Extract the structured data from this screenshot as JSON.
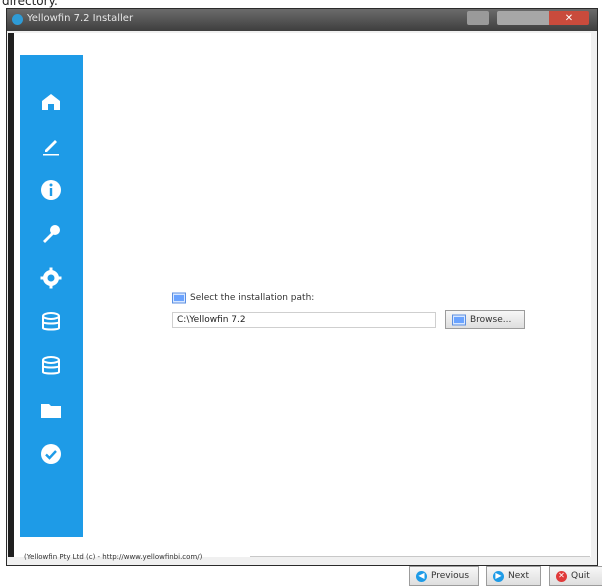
{
  "top_cropped_text": "directory.",
  "window": {
    "title": "Yellowfin 7.2 Installer",
    "close_symbol": "✕",
    "icon": "yellowfin-logo-icon"
  },
  "sidebar": {
    "color": "#1e9be7",
    "items": [
      {
        "icon": "home-icon"
      },
      {
        "icon": "pen-icon"
      },
      {
        "icon": "info-icon"
      },
      {
        "icon": "key-icon"
      },
      {
        "icon": "gear-icon"
      },
      {
        "icon": "database-icon"
      },
      {
        "icon": "database-stack-icon"
      },
      {
        "icon": "folder-icon"
      },
      {
        "icon": "check-icon"
      }
    ]
  },
  "main": {
    "dir_label": "Select the installation path:",
    "path_value": "C:\\Yellowfin 7.2",
    "browse_label": "Browse..."
  },
  "footer": {
    "credit": "(Yellowfin Pty Ltd (c) - http://www.yellowfinbi.com/)",
    "buttons": {
      "previous": "Previous",
      "next": "Next",
      "quit": "Quit"
    }
  }
}
